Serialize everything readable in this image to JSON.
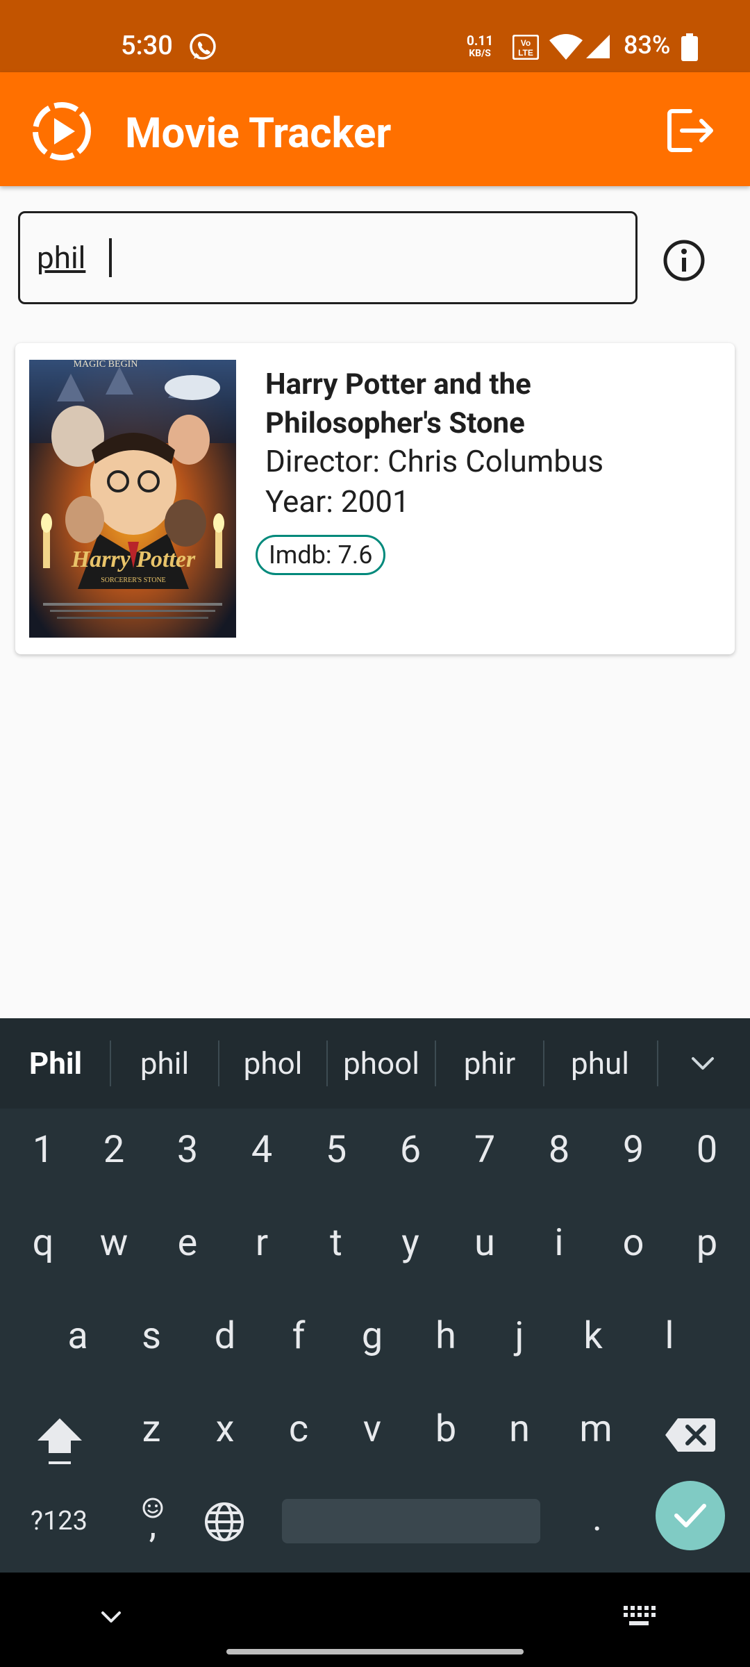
{
  "status_bar": {
    "time": "5:30",
    "net_speed": "0.11",
    "net_unit": "KB/S",
    "battery": "83%"
  },
  "app_bar": {
    "title": "Movie Tracker"
  },
  "search": {
    "value": "phil"
  },
  "results": [
    {
      "title": "Harry Potter and the Philosopher's Stone",
      "director": "Director: Chris Columbus",
      "year": "Year: 2001",
      "imdb": "Imdb: 7.6",
      "poster_title": "Harry Potter",
      "poster_subtitle": "SORCERER'S STONE",
      "poster_top": "MAGIC BEGIN"
    }
  ],
  "keyboard": {
    "suggestions": [
      "Phil",
      "phil",
      "phol",
      "phool",
      "phir",
      "phul"
    ],
    "row_numbers": [
      "1",
      "2",
      "3",
      "4",
      "5",
      "6",
      "7",
      "8",
      "9",
      "0"
    ],
    "row1": [
      "q",
      "w",
      "e",
      "r",
      "t",
      "y",
      "u",
      "i",
      "o",
      "p"
    ],
    "row2": [
      "a",
      "s",
      "d",
      "f",
      "g",
      "h",
      "j",
      "k",
      "l"
    ],
    "row3": [
      "z",
      "x",
      "c",
      "v",
      "b",
      "n",
      "m"
    ],
    "symbols_key": "?123",
    "comma_key": ",",
    "period_key": "."
  },
  "colors": {
    "status_bar": "#c25400",
    "app_bar": "#ff7000",
    "chip_border": "#00897b",
    "keyboard_bg": "#263238",
    "enter_key": "#80cbc4"
  }
}
